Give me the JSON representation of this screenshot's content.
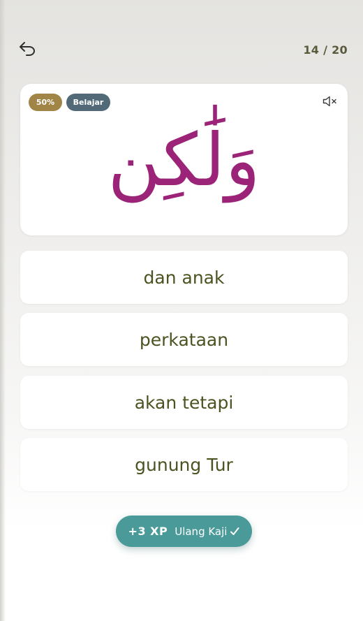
{
  "header": {
    "back_icon": "undo-arrow-icon",
    "progress_counter": "14 / 20"
  },
  "word_card": {
    "percent_badge": "50%",
    "mode_badge": "Belajar",
    "mute_icon": "speaker-muted-icon",
    "arabic_word": "وَلَٰكِن",
    "colors": {
      "arabic_word": "#9c2478",
      "percent_badge": "#a08547",
      "mode_badge": "#526a78"
    }
  },
  "answers": [
    {
      "label": "dan anak"
    },
    {
      "label": "perkataan"
    },
    {
      "label": "akan tetapi"
    },
    {
      "label": "gunung Tur"
    }
  ],
  "xp_button": {
    "amount": "+3 XP",
    "label": "Ulang Kaji",
    "icon": "check-icon",
    "color": "#4a9a99"
  }
}
